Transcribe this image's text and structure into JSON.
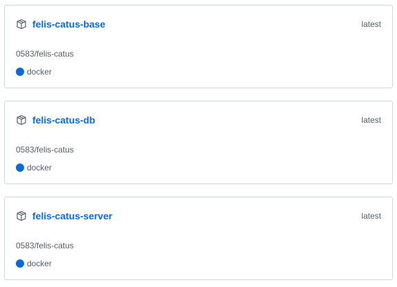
{
  "packages": [
    {
      "name": "felis-catus-base",
      "version": "latest",
      "repository": "0583/felis-catus",
      "type": "docker",
      "icon": "package-icon"
    },
    {
      "name": "felis-catus-db",
      "version": "latest",
      "repository": "0583/felis-catus",
      "type": "docker",
      "icon": "package-icon"
    },
    {
      "name": "felis-catus-server",
      "version": "latest",
      "repository": "0583/felis-catus",
      "type": "docker",
      "icon": "package-icon"
    }
  ],
  "colors": {
    "link": "#0969da",
    "docker_dot": "#0969da",
    "muted_text": "#57606a",
    "border": "#d0d7de"
  }
}
